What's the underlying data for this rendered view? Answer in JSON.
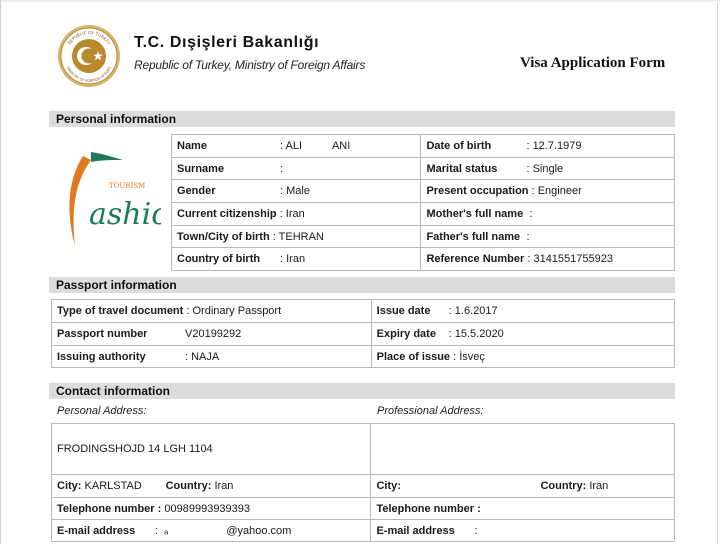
{
  "header": {
    "ministry_title": "T.C. Dışişleri Bakanlığı",
    "ministry_subtitle": "Republic of Turkey, Ministry of Foreign  Affairs",
    "form_title": "Visa Application Form",
    "seal_top_text": "REPUBLIC OF TURKEY",
    "seal_bottom_text": "MINISTRY OF FOREIGN AFFAIRS"
  },
  "logo": {
    "brand": "ashion",
    "tag": "TOURISM"
  },
  "personal": {
    "title": "Personal information",
    "left": [
      {
        "label": "Name",
        "value": ": ALI          ANI"
      },
      {
        "label": "Surname",
        "value": ":"
      },
      {
        "label": "Gender",
        "value": ": Male"
      },
      {
        "label": "Current citizenship",
        "value": ": Iran"
      },
      {
        "label": "Town/City of birth",
        "value": ": TEHRAN"
      },
      {
        "label": "Country of birth",
        "value": ": Iran"
      }
    ],
    "right": [
      {
        "label": "Date of birth",
        "value": ": 12.7.1979"
      },
      {
        "label": "Marital status",
        "value": ": Single"
      },
      {
        "label": "Present occupation",
        "value": ": Engineer"
      },
      {
        "label": "Mother's full name",
        "value": ":"
      },
      {
        "label": "Father's full name",
        "value": ":"
      },
      {
        "label": "Reference Number",
        "value": ": 3141551755923"
      }
    ]
  },
  "passport": {
    "title": "Passport information",
    "left": [
      {
        "label": "Type of travel document",
        "value": ": Ordinary Passport"
      },
      {
        "label": "Passport number",
        "value": "V20199292"
      },
      {
        "label": "Issuing authority",
        "value": ": NAJA"
      }
    ],
    "right": [
      {
        "label": "Issue date",
        "value": ": 1.6.2017"
      },
      {
        "label": "Expiry date",
        "value": ": 15.5.2020"
      },
      {
        "label": "Place of issue",
        "value": ": İsveç"
      }
    ]
  },
  "contact": {
    "title": "Contact information",
    "personal_address_label": "Personal Address:",
    "professional_address_label": "Professional Address:",
    "personal_address": "FRODINGSHOJD 14 LGH 1104",
    "professional_address": "",
    "city_label": "City:",
    "personal_city": "KARLSTAD",
    "professional_city": "",
    "country_label": "Country:",
    "personal_country": "Iran",
    "professional_country": "Iran",
    "telephone_label": "Telephone number :",
    "personal_telephone": "00989993939393",
    "professional_telephone": "",
    "email_label": "E-mail address",
    "personal_email": ":  ₐ                   @yahoo.com",
    "professional_email": ":"
  },
  "colors": {
    "section_bg": "#dcdcdc",
    "border": "#b8b8b8",
    "seal_gold": "#b8892e",
    "logo_orange": "#e07a1f",
    "logo_green": "#1f7a5a"
  }
}
